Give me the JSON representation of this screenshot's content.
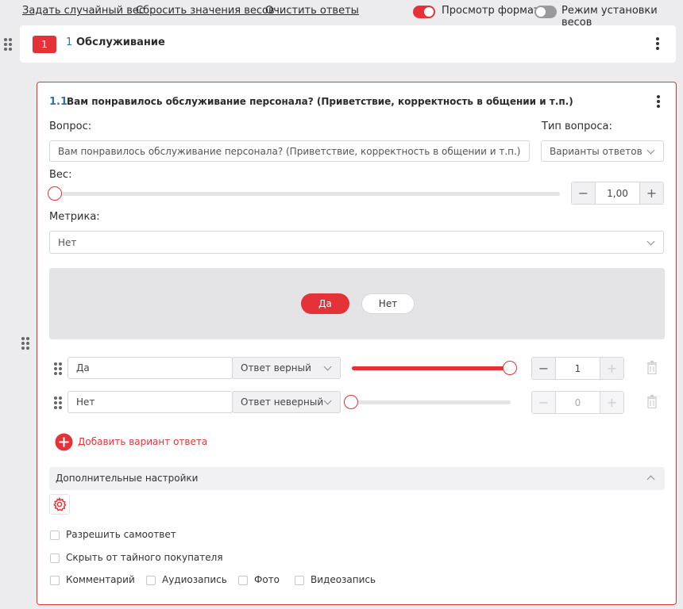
{
  "top_links": {
    "random_weight": "Задать случайный вес",
    "reset_weights": "Сбросить значения весов",
    "clear_answers": "Очистить ответы"
  },
  "toggles": {
    "format_preview": {
      "label": "Просмотр формата",
      "on": true
    },
    "weights_mode": {
      "label": "Режим установки весов",
      "on": false
    }
  },
  "section": {
    "badge": "1",
    "number": "1",
    "title": "Обслуживание"
  },
  "question": {
    "number": "1.1",
    "title": "Вам понравилось обслуживание персонала? (Приветствие, корректность в общении и т.п.)",
    "question_label": "Вопрос:",
    "question_value": "Вам понравилось обслуживание персонала? (Приветствие, корректность в общении и т.п.)",
    "type_label": "Тип вопроса:",
    "type_value": "Варианты ответов",
    "weight_label": "Вес:",
    "weight_value": "1,00",
    "weight_slider_fraction": 0.0,
    "metric_label": "Метрика:",
    "metric_value": "Нет"
  },
  "preview": {
    "yes": "Да",
    "no": "Нет"
  },
  "answers": [
    {
      "text": "Да",
      "status": "Ответ верный",
      "value": "1",
      "slider_fraction": 1.0
    },
    {
      "text": "Нет",
      "status": "Ответ неверный",
      "value": "0",
      "slider_fraction": 0.0
    }
  ],
  "add_answer_label": "Добавить вариант ответа",
  "extra_settings": {
    "title": "Дополнительные настройки",
    "options": {
      "allow_self_answer": "Разрешить самоответ",
      "hide_from_shopper": "Скрыть от тайного покупателя",
      "comment": "Комментарий",
      "audio": "Аудиозапись",
      "photo": "Фото",
      "video": "Видеозапись"
    }
  },
  "colors": {
    "accent": "#e53238",
    "toggle_off": "#9a9a9e",
    "background": "#ececee"
  },
  "icons": [
    "drag-handle-icon",
    "more-vertical-icon",
    "chevron-down-icon",
    "chevron-up-icon",
    "minus-icon",
    "plus-icon",
    "trash-icon",
    "add-circle-icon",
    "gear-icon"
  ]
}
